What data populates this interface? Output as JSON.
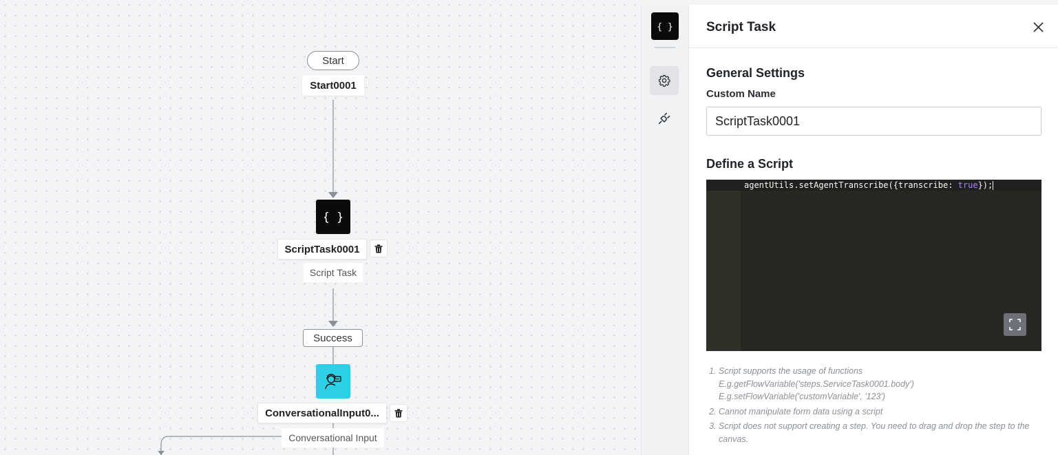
{
  "canvas": {
    "start_pill": "Start",
    "start_label": "Start0001",
    "script_node": {
      "name": "ScriptTask0001",
      "type_label": "Script Task",
      "icon": "curly-braces-icon"
    },
    "success_pill": "Success",
    "conv_node": {
      "name": "ConversationalInput0...",
      "type_label": "Conversational Input",
      "icon": "agent-headset-icon",
      "color": "#2ed0e8"
    },
    "trash_icon": "trash-icon"
  },
  "panel": {
    "title": "Script Task",
    "general_settings": "General Settings",
    "custom_name_label": "Custom Name",
    "custom_name_value": "ScriptTask0001",
    "define_script": "Define a Script",
    "code": {
      "prefix": "agentUtils.setAgentTranscribe({transcribe: ",
      "keyword": "true",
      "suffix": "});"
    },
    "notes": {
      "n1": "Script supports the usage of functions",
      "n1_ex1": "E.g.getFlowVariable('steps.ServiceTask0001.body')",
      "n1_ex2": "E.g.setFlowVariable('customVariable', '123')",
      "n2": "Cannot manipulate form data using a script",
      "n3": "Script does not support creating a step. You need to drag and drop the step to the canvas."
    }
  },
  "rail": {
    "logo_icon": "curly-braces-icon",
    "settings_icon": "gear-icon",
    "plug_icon": "plug-icon"
  }
}
